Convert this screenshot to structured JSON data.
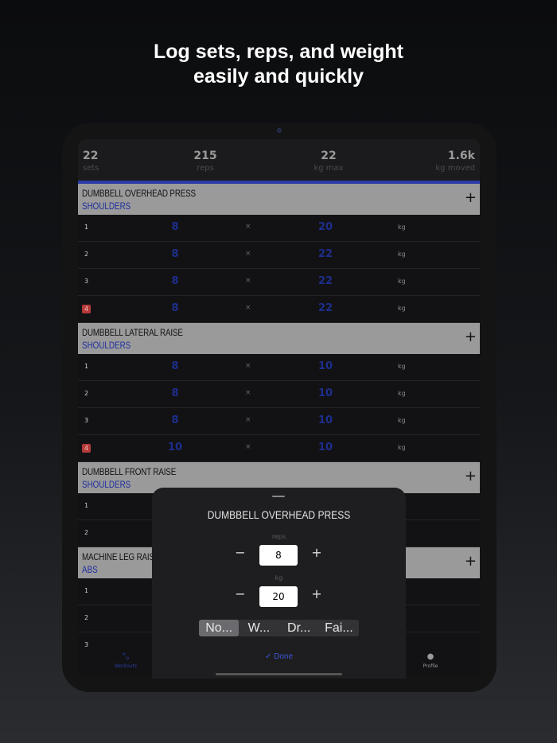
{
  "headline": [
    "Log sets, reps, and weight",
    "easily and quickly"
  ],
  "stats": [
    {
      "value": "22",
      "label": "sets"
    },
    {
      "value": "215",
      "label": "reps"
    },
    {
      "value": "22",
      "label": "kg max"
    },
    {
      "value": "1.6k",
      "label": "kg moved"
    }
  ],
  "times_symbol": "×",
  "unit": "kg",
  "plus": "+",
  "exercises": [
    {
      "name": "DUMBBELL OVERHEAD PRESS",
      "muscle": "SHOULDERS",
      "sets": [
        {
          "n": "1",
          "reps": "8",
          "weight": "20",
          "flag": false
        },
        {
          "n": "2",
          "reps": "8",
          "weight": "22",
          "flag": false
        },
        {
          "n": "3",
          "reps": "8",
          "weight": "22",
          "flag": false
        },
        {
          "n": "4",
          "reps": "8",
          "weight": "22",
          "flag": true
        }
      ]
    },
    {
      "name": "DUMBBELL LATERAL RAISE",
      "muscle": "SHOULDERS",
      "sets": [
        {
          "n": "1",
          "reps": "8",
          "weight": "10",
          "flag": false
        },
        {
          "n": "2",
          "reps": "8",
          "weight": "10",
          "flag": false
        },
        {
          "n": "3",
          "reps": "8",
          "weight": "10",
          "flag": false
        },
        {
          "n": "4",
          "reps": "10",
          "weight": "10",
          "flag": true
        }
      ]
    },
    {
      "name": "DUMBBELL FRONT RAISE",
      "muscle": "SHOULDERS",
      "sets": [
        {
          "n": "1"
        },
        {
          "n": "2"
        }
      ]
    },
    {
      "name": "MACHINE LEG RAISE",
      "muscle": "ABS",
      "sets": [
        {
          "n": "1"
        },
        {
          "n": "2"
        },
        {
          "n": "3"
        }
      ]
    }
  ],
  "tabs": [
    {
      "label": "Workouts",
      "icon": "dumbbell-icon",
      "active": true
    },
    {
      "label": "Profile",
      "icon": "person-icon",
      "active": false
    }
  ],
  "sheet": {
    "title": "DUMBBELL OVERHEAD PRESS",
    "reps_label": "reps",
    "reps_value": "8",
    "kg_label": "kg",
    "kg_value": "20",
    "minus": "−",
    "plus": "+",
    "set_types": [
      "No...",
      "W...",
      "Dr...",
      "Fai..."
    ],
    "selected_type_index": 0,
    "done_label": "Done"
  },
  "colors": {
    "accent": "#2b3aa8",
    "value_blue": "#1d2e8c",
    "warning": "#b43a3a",
    "done_blue": "#3b55d6"
  }
}
